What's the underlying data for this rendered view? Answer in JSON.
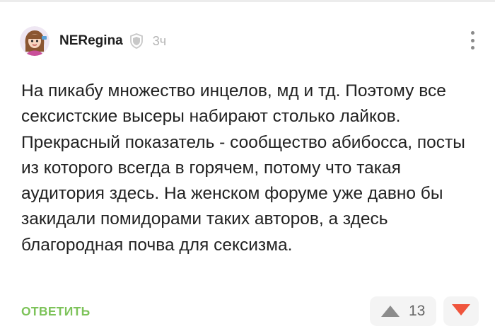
{
  "comment": {
    "author": "NERegina",
    "time": "3ч",
    "text": "На пикабу множество инцелов, мд и тд. Поэтому все сексистские высеры набирают столько лайков. Прекрасный показатель - сообщество абибосса, посты из которого всегда в горячем, потому что такая аудитория здесь. На женском форуме уже давно бы закидали помидорами таких авторов, а здесь благородная почва для сексизма.",
    "reply_label": "ОТВЕТИТЬ",
    "rating": "13"
  },
  "colors": {
    "reply": "#7dc35a",
    "downvote": "#f0553d",
    "upvote": "#8c8c8c",
    "badge": "#c8c8c8"
  },
  "icons": {
    "badge": "shield-check-icon",
    "more": "more-vertical-icon",
    "upvote": "triangle-up-icon",
    "downvote": "triangle-down-icon"
  }
}
